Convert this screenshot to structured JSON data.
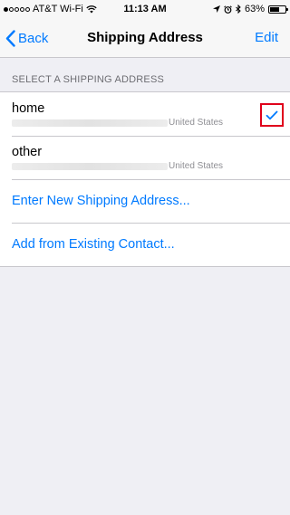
{
  "status_bar": {
    "carrier": "AT&T Wi-Fi",
    "time": "11:13 AM",
    "battery": "63%",
    "battery_level": 0.63
  },
  "nav": {
    "back_label": "Back",
    "title": "Shipping Address",
    "edit_label": "Edit"
  },
  "section": {
    "header": "SELECT A SHIPPING ADDRESS"
  },
  "addresses": [
    {
      "name": "home",
      "country": "United States",
      "selected": true
    },
    {
      "name": "other",
      "country": "United States",
      "selected": false
    }
  ],
  "actions": {
    "new_address": "Enter New Shipping Address...",
    "from_contact": "Add from Existing Contact..."
  },
  "colors": {
    "accent": "#007aff",
    "highlight": "#e0001b"
  }
}
